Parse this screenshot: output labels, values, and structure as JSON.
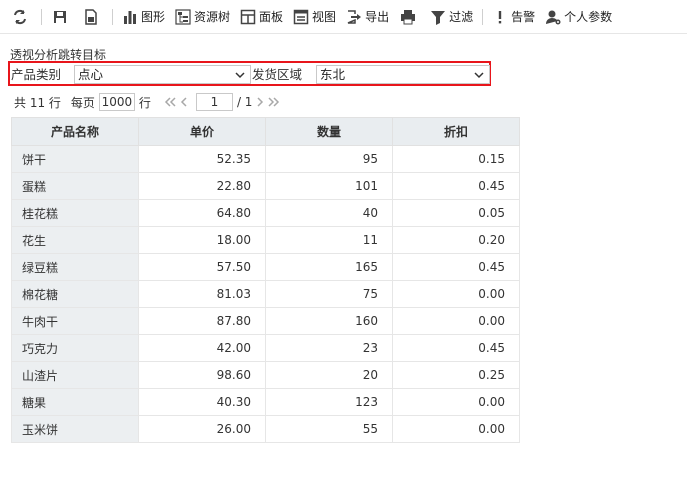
{
  "toolbar": {
    "chart": "图形",
    "resource_tree": "资源树",
    "panel": "面板",
    "view": "视图",
    "export": "导出",
    "filter": "过滤",
    "alert": "告警",
    "personal_params": "个人参数"
  },
  "page_title": "透视分析跳转目标",
  "filters": {
    "category_label": "产品类别",
    "category_value": "点心",
    "region_label": "发货区域",
    "region_value": "东北"
  },
  "pager": {
    "total_text": "共 11 行",
    "per_page_label": "每页",
    "per_page_value": "1000",
    "per_page_unit": "行",
    "current_page": "1",
    "total_pages": "/ 1"
  },
  "table": {
    "headers": [
      "产品名称",
      "单价",
      "数量",
      "折扣"
    ],
    "rows": [
      [
        "饼干",
        "52.35",
        "95",
        "0.15"
      ],
      [
        "蛋糕",
        "22.80",
        "101",
        "0.45"
      ],
      [
        "桂花糕",
        "64.80",
        "40",
        "0.05"
      ],
      [
        "花生",
        "18.00",
        "11",
        "0.20"
      ],
      [
        "绿豆糕",
        "57.50",
        "165",
        "0.45"
      ],
      [
        "棉花糖",
        "81.03",
        "75",
        "0.00"
      ],
      [
        "牛肉干",
        "87.80",
        "160",
        "0.00"
      ],
      [
        "巧克力",
        "42.00",
        "23",
        "0.45"
      ],
      [
        "山渣片",
        "98.60",
        "20",
        "0.25"
      ],
      [
        "糖果",
        "40.30",
        "123",
        "0.00"
      ],
      [
        "玉米饼",
        "26.00",
        "55",
        "0.00"
      ]
    ]
  },
  "colors": {
    "highlight_border": "#e8151b",
    "header_bg": "#e9edf0",
    "name_col_bg": "#eceff1"
  }
}
